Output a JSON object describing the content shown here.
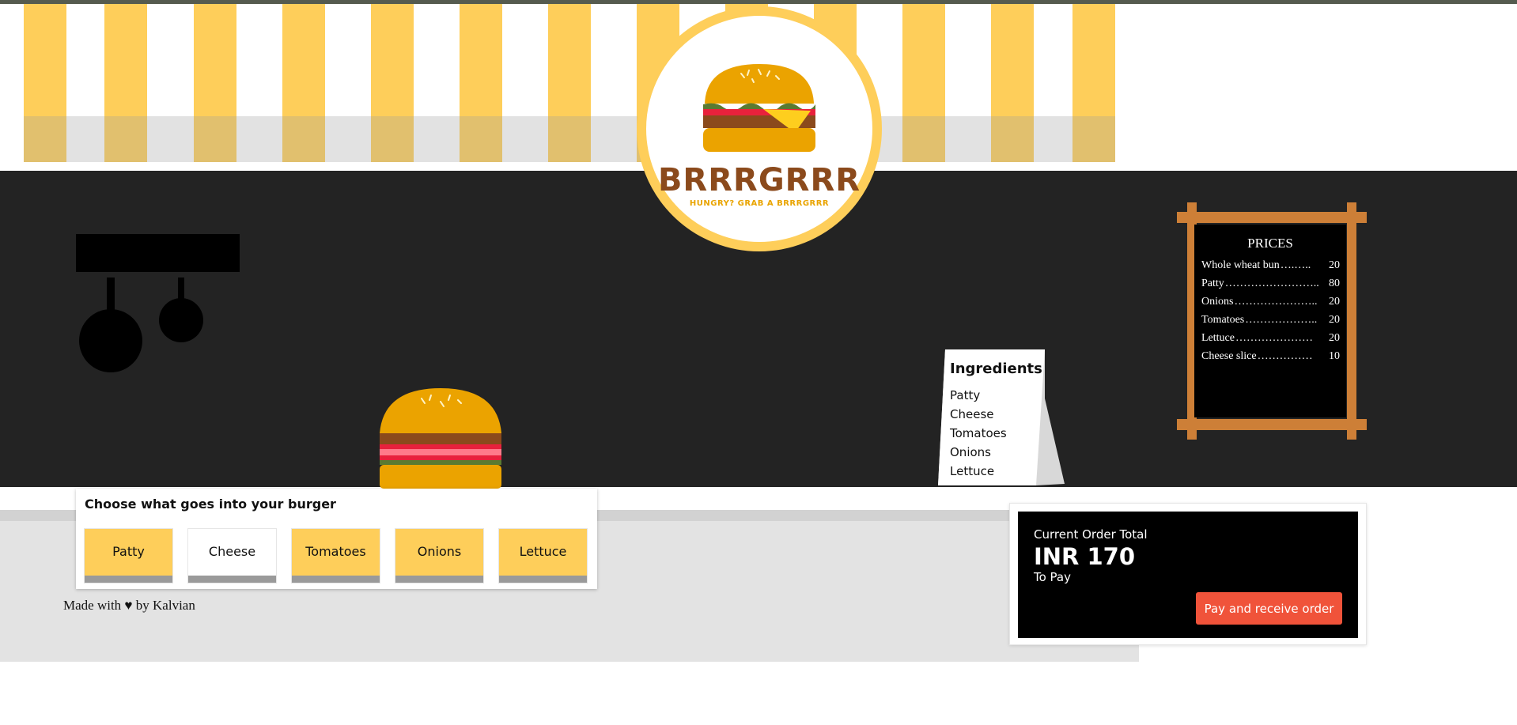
{
  "brand": {
    "name": "BRRRGRRR",
    "tagline": "HUNGRY? GRAB A BRRRGRRR",
    "primary_color": "#fece5a",
    "brown_color": "#8b4a1c",
    "bun_color": "#eba300"
  },
  "prices": {
    "title": "PRICES",
    "items": [
      {
        "name": "Whole wheat bun",
        "dots": "….…..",
        "price": "20"
      },
      {
        "name": "Patty",
        "dots": "……………………..",
        "price": "80"
      },
      {
        "name": "Onions",
        "dots": "…………………..",
        "price": "20"
      },
      {
        "name": "Tomatoes",
        "dots": "………………..",
        "price": "20"
      },
      {
        "name": "Lettuce",
        "dots": "…………………",
        "price": "20"
      },
      {
        "name": "Cheese slice",
        "dots": "……………",
        "price": "10"
      }
    ]
  },
  "ingredients_card": {
    "title": "Ingredients",
    "items": [
      "Patty",
      "Cheese",
      "Tomatoes",
      "Onions",
      "Lettuce"
    ]
  },
  "chooser": {
    "title": "Choose what goes into your burger",
    "options": [
      {
        "label": "Patty",
        "selected": true
      },
      {
        "label": "Cheese",
        "selected": false
      },
      {
        "label": "Tomatoes",
        "selected": true
      },
      {
        "label": "Onions",
        "selected": true
      },
      {
        "label": "Lettuce",
        "selected": true
      }
    ]
  },
  "footer": {
    "credit": "Made with ♥ by Kalvian"
  },
  "order": {
    "label": "Current Order Total",
    "amount": "INR 170",
    "sub": "To Pay",
    "button": "Pay and receive order",
    "button_color": "#f0533a"
  }
}
